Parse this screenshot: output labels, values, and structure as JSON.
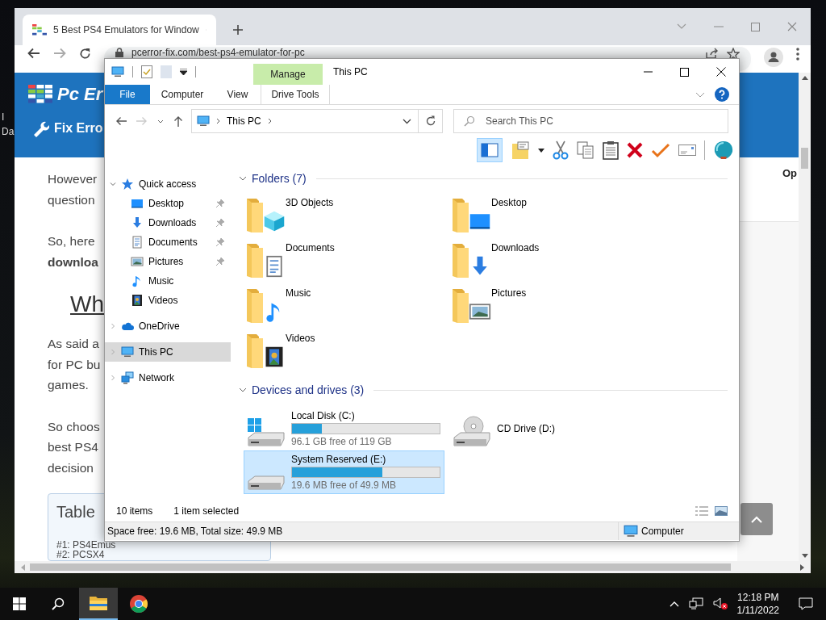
{
  "desktop": {
    "labels": [
      "I",
      "Da"
    ]
  },
  "browser": {
    "tab": {
      "title": "5 Best PS4 Emulators for Window"
    },
    "url": "pcerror-fix.com/best-ps4-emulator-for-pc",
    "site": {
      "logo": "Pc Er",
      "nav_item": "Fix Erro"
    },
    "article": [
      {
        "kind": "text",
        "lines": [
          "However",
          "question"
        ]
      },
      {
        "kind": "text",
        "lines": [
          "So, here",
          "**downloa**"
        ]
      },
      {
        "kind": "heading",
        "lines": [
          "Wh"
        ]
      },
      {
        "kind": "text",
        "lines": [
          "As said a",
          "for PC bu",
          "games."
        ]
      },
      {
        "kind": "text",
        "lines": [
          "So choos",
          "best PS4",
          "decision"
        ]
      }
    ],
    "toc": {
      "title": "Table",
      "items": [
        "#1: PS4Emus",
        "#2: PCSX4"
      ]
    },
    "sidebar": {
      "label": "Op"
    }
  },
  "explorer": {
    "title": "This PC",
    "ribbon_tabs": [
      {
        "label": "File",
        "kind": "file"
      },
      {
        "label": "Computer",
        "kind": "tab"
      },
      {
        "label": "View",
        "kind": "tab"
      },
      {
        "label": "Drive Tools",
        "kind": "contextual",
        "group": "Manage"
      }
    ],
    "address": {
      "path": [
        "This PC"
      ]
    },
    "search": {
      "placeholder": "Search This PC"
    },
    "toolbar": {
      "pane_button": {
        "on": true
      }
    },
    "nav": [
      {
        "label": "Quick access",
        "kind": "star",
        "expanded": true,
        "selected": false,
        "children": [
          {
            "label": "Desktop",
            "kind": "desktop",
            "pinned": true,
            "selected": false
          },
          {
            "label": "Downloads",
            "kind": "downloads",
            "pinned": true,
            "selected": false
          },
          {
            "label": "Documents",
            "kind": "documents",
            "pinned": true,
            "selected": false
          },
          {
            "label": "Pictures",
            "kind": "pictures",
            "pinned": true,
            "selected": false
          },
          {
            "label": "Music",
            "kind": "music",
            "pinned": false,
            "selected": false
          },
          {
            "label": "Videos",
            "kind": "videos",
            "pinned": false,
            "selected": false
          }
        ]
      },
      {
        "label": "OneDrive",
        "kind": "cloud",
        "expanded": false,
        "selected": false
      },
      {
        "label": "This PC",
        "kind": "pc",
        "expanded": false,
        "selected": true
      },
      {
        "label": "Network",
        "kind": "network",
        "expanded": false,
        "selected": false
      }
    ],
    "sections": [
      {
        "title": "Folders (7)",
        "kind": "folders",
        "expanded": true,
        "items": [
          {
            "label": "3D Objects",
            "kind": "cube",
            "selected": false
          },
          {
            "label": "Desktop",
            "kind": "desktop",
            "selected": false
          },
          {
            "label": "Documents",
            "kind": "documents",
            "selected": false
          },
          {
            "label": "Downloads",
            "kind": "downloads",
            "selected": false
          },
          {
            "label": "Music",
            "kind": "music",
            "selected": false
          },
          {
            "label": "Pictures",
            "kind": "pictures",
            "selected": false
          },
          {
            "label": "Videos",
            "kind": "videos",
            "selected": false
          }
        ]
      },
      {
        "title": "Devices and drives (3)",
        "kind": "drives",
        "expanded": true,
        "items": [
          {
            "label": "Local Disk (C:)",
            "kind": "system",
            "level": 0.2,
            "reading": "96.1 GB free of 119 GB",
            "selected": false
          },
          {
            "label": "CD Drive (D:)",
            "kind": "cd",
            "selected": false
          },
          {
            "label": "System Reserved (E:)",
            "kind": "disk",
            "level": 0.61,
            "reading": "19.6 MB free of 49.9 MB",
            "selected": true
          }
        ]
      }
    ],
    "status": {
      "count": "10 items",
      "selection": "1 item selected"
    },
    "details_bar": {
      "space": "Space free: 19.6 MB, Total size: 49.9 MB",
      "location": "Computer"
    }
  },
  "taskbar": {
    "apps": [
      {
        "kind": "explorer",
        "active": true
      },
      {
        "kind": "browser",
        "active": false
      }
    ],
    "time": "12:18 PM",
    "date": "1/11/2022"
  }
}
